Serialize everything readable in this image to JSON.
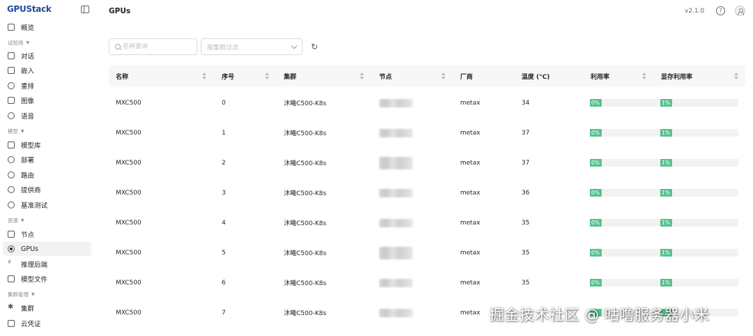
{
  "app": {
    "logo": "GPUStack",
    "version": "v2.1.0",
    "help_label": "?"
  },
  "sidebar": {
    "items": [
      {
        "label": "概览",
        "icon": "grid-icon"
      },
      {
        "label": "试验场",
        "type": "group"
      },
      {
        "label": "对话",
        "icon": "chat-icon"
      },
      {
        "label": "嵌入",
        "icon": "embed-icon"
      },
      {
        "label": "重排",
        "icon": "rerank-icon"
      },
      {
        "label": "图像",
        "icon": "image-icon"
      },
      {
        "label": "语音",
        "icon": "audio-icon"
      },
      {
        "label": "模型",
        "type": "group"
      },
      {
        "label": "模型库",
        "icon": "layers-icon"
      },
      {
        "label": "部署",
        "icon": "rocket-icon"
      },
      {
        "label": "路由",
        "icon": "route-icon"
      },
      {
        "label": "提供商",
        "icon": "cloud-icon"
      },
      {
        "label": "基准测试",
        "icon": "gauge-icon"
      },
      {
        "label": "资源",
        "type": "group"
      },
      {
        "label": "节点",
        "icon": "server-icon"
      },
      {
        "label": "GPUs",
        "icon": "gpu-icon",
        "active": true
      },
      {
        "label": "推理后端",
        "icon": "bolt-icon"
      },
      {
        "label": "模型文件",
        "icon": "files-icon"
      },
      {
        "label": "集群管理",
        "type": "group"
      },
      {
        "label": "集群",
        "icon": "cluster-icon"
      },
      {
        "label": "云凭证",
        "icon": "credential-icon"
      }
    ]
  },
  "header": {
    "title": "GPUs"
  },
  "toolbar": {
    "search_placeholder": "名称查询",
    "cluster_filter_placeholder": "按集群过滤"
  },
  "table": {
    "columns": [
      "名称",
      "序号",
      "集群",
      "节点",
      "厂商",
      "温度 (°C)",
      "利用率",
      "显存利用率"
    ],
    "rows": [
      {
        "name": "MXC500",
        "index": "0",
        "cluster": "沐曦C500-K8s",
        "vendor": "metax",
        "temp": "34",
        "util": 0,
        "util_label": "0%",
        "mem": 1,
        "mem_label": "1%"
      },
      {
        "name": "MXC500",
        "index": "1",
        "cluster": "沐曦C500-K8s",
        "vendor": "metax",
        "temp": "37",
        "util": 0,
        "util_label": "0%",
        "mem": 1,
        "mem_label": "1%"
      },
      {
        "name": "MXC500",
        "index": "2",
        "cluster": "沐曦C500-K8s",
        "vendor": "metax",
        "temp": "37",
        "util": 0,
        "util_label": "0%",
        "mem": 1,
        "mem_label": "1%"
      },
      {
        "name": "MXC500",
        "index": "3",
        "cluster": "沐曦C500-K8s",
        "vendor": "metax",
        "temp": "36",
        "util": 0,
        "util_label": "0%",
        "mem": 1,
        "mem_label": "1%"
      },
      {
        "name": "MXC500",
        "index": "4",
        "cluster": "沐曦C500-K8s",
        "vendor": "metax",
        "temp": "35",
        "util": 0,
        "util_label": "0%",
        "mem": 1,
        "mem_label": "1%"
      },
      {
        "name": "MXC500",
        "index": "5",
        "cluster": "沐曦C500-K8s",
        "vendor": "metax",
        "temp": "35",
        "util": 0,
        "util_label": "0%",
        "mem": 1,
        "mem_label": "1%"
      },
      {
        "name": "MXC500",
        "index": "6",
        "cluster": "沐曦C500-K8s",
        "vendor": "metax",
        "temp": "35",
        "util": 0,
        "util_label": "0%",
        "mem": 1,
        "mem_label": "1%"
      },
      {
        "name": "MXC500",
        "index": "7",
        "cluster": "沐曦C500-K8s",
        "vendor": "metax",
        "temp": "",
        "util": 0,
        "util_label": "",
        "mem": 1,
        "mem_label": ""
      }
    ]
  },
  "colors": {
    "accent": "#55c28d",
    "logo": "#1f4e9c"
  },
  "watermark": "掘金技术社区 @ 咕噜服务器小米"
}
